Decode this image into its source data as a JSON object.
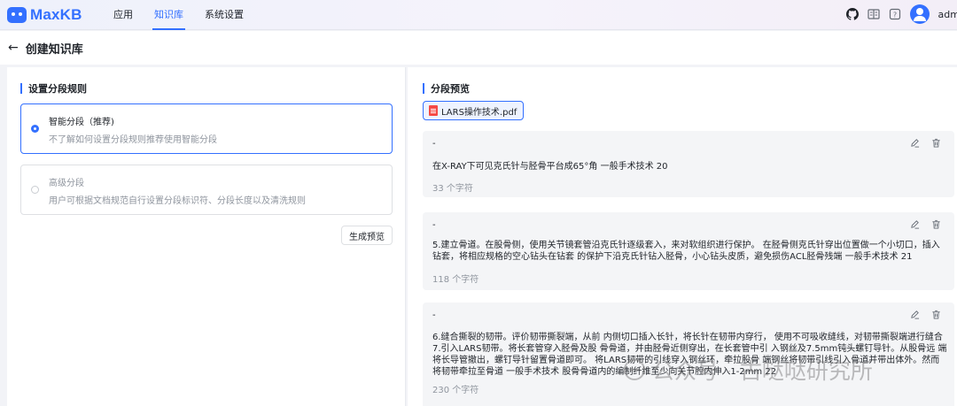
{
  "app": {
    "name": "MaxKB"
  },
  "nav": {
    "items": [
      "应用",
      "知识库",
      "系统设置"
    ],
    "active": "知识库"
  },
  "user": {
    "name": "admi"
  },
  "page": {
    "title": "创建知识库"
  },
  "left": {
    "title": "设置分段规则",
    "options": [
      {
        "title": "智能分段（推荐)",
        "desc": "不了解如何设置分段规则推荐使用智能分段",
        "selected": true
      },
      {
        "title": "高级分段",
        "desc": "用户可根据文档规范自行设置分段标识符、分段长度以及清洗规则",
        "selected": false
      }
    ],
    "preview_button": "生成预览"
  },
  "right": {
    "title": "分段预览",
    "file_tab": "LARS操作技术.pdf",
    "chunks": [
      {
        "dash": "-",
        "text": "在X-RAY下可见克氏针与胫骨平台成65°角 一般手术技术 20",
        "count": "33 个字符"
      },
      {
        "dash": "-",
        "text": "5.建立骨道。在股骨侧，使用关节镜套管沿克氏针逐级套入，来对软组织进行保护。 在胫骨侧克氏针穿出位置做一个小切口，插入钻套，将相应规格的空心钻头在钻套 的保护下沿克氏针钻入胫骨，小心钻头皮质，避免损伤ACL胫骨残端 一般手术技术 21",
        "count": "118 个字符"
      },
      {
        "dash": "-",
        "text": "6.缝合撕裂的韧带。评价韧带撕裂端，从前 内侧切口插入长针，将长针在韧带内穿行， 使用不可吸收缝线，对韧带撕裂端进行缝合 7.引入LARS韧带。将长套管穿入胫骨及股 骨骨道，并由胫骨近侧穿出，在长套管中引 入钢丝及7.5mm钝头螺钉导针。从股骨远 端将长导管撤出，螺钉导针留置骨道即可。 将LARS韧带的引线穿入钢丝环，牵拉股骨 端钢丝将韧带引线引入骨道并带出体外。然而将韧带牵拉至骨道 一般手术技术 股骨骨道内的编制纤维至少向关节腔内伸入1-2mm 22",
        "count": "230 个字符"
      }
    ]
  },
  "watermark": {
    "text": "公众号 · 古哒哒研究所"
  }
}
